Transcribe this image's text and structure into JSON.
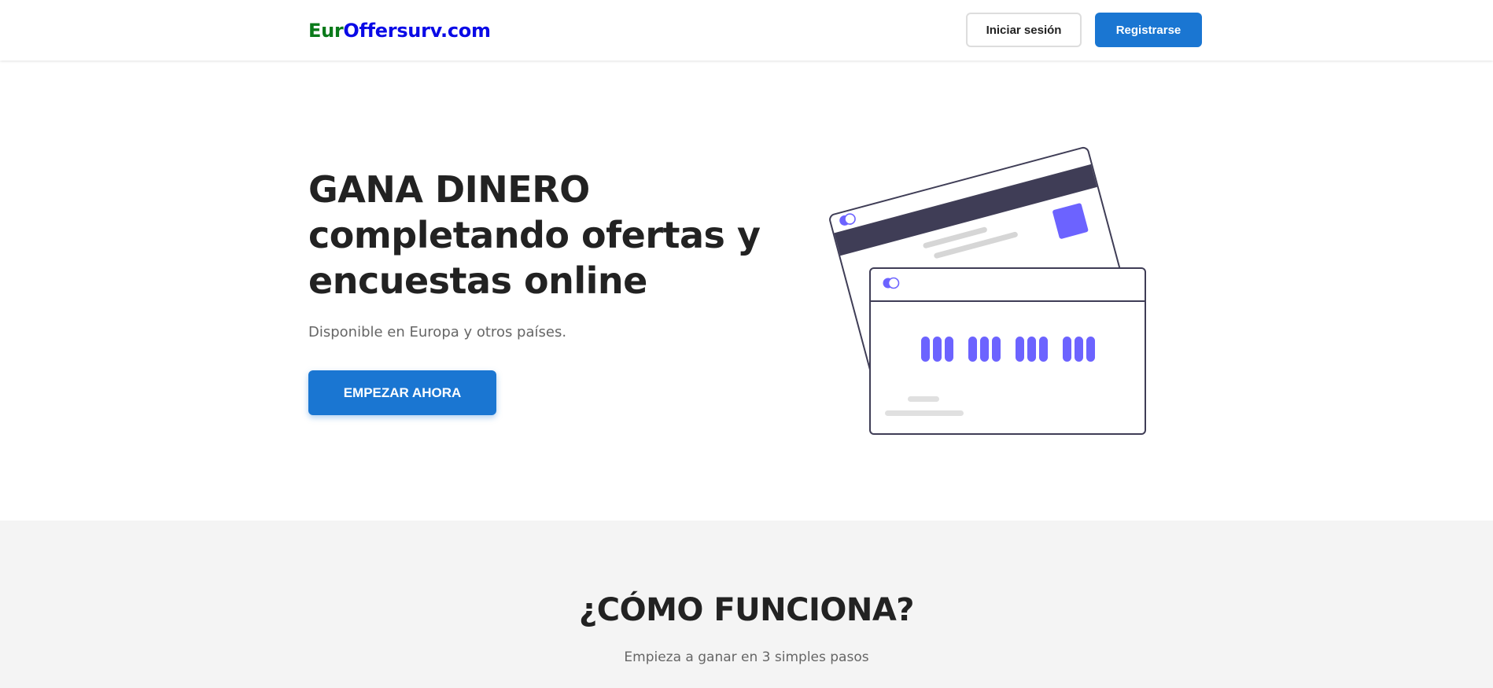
{
  "header": {
    "logo_part1": "Eur",
    "logo_part2": "Offersurv.com",
    "login_label": "Iniciar sesión",
    "register_label": "Registrarse"
  },
  "hero": {
    "title_line1": "GANA DINERO",
    "title_line2": "completando ofertas y",
    "title_line3": "encuestas online",
    "subtitle": "Disponible en Europa y otros países.",
    "cta_label": "EMPEZAR AHORA",
    "illustration_icon": "credit-cards-illustration"
  },
  "how_it_works": {
    "title": "¿CÓMO FUNCIONA?",
    "subtitle": "Empieza a ganar en 3 simples pasos"
  },
  "colors": {
    "logo_green": "#0a7a1a",
    "logo_blue": "#0a0ae6",
    "primary": "#1a76d2",
    "illustration_accent": "#6c63ff",
    "illustration_dark": "#3f3d56",
    "section_bg": "#f4f4f4"
  }
}
